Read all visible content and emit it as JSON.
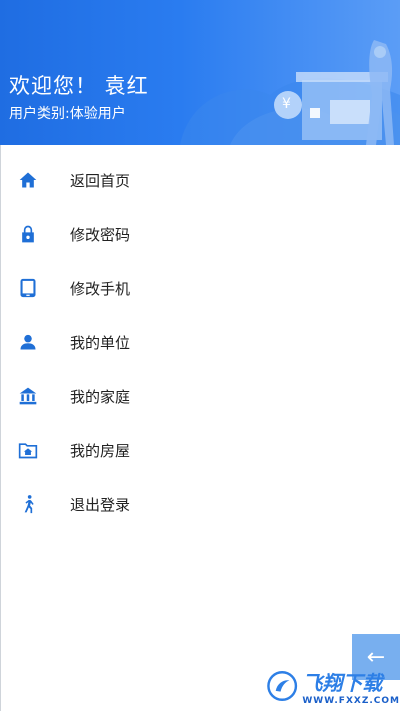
{
  "header": {
    "welcome": "欢迎您！ 袁红",
    "user_type": "用户类别:体验用户",
    "art_symbol": "¥"
  },
  "menu": {
    "items": [
      {
        "label": "返回首页",
        "icon": "home-icon"
      },
      {
        "label": "修改密码",
        "icon": "lock-icon"
      },
      {
        "label": "修改手机",
        "icon": "phone-icon"
      },
      {
        "label": "我的单位",
        "icon": "person-icon"
      },
      {
        "label": "我的家庭",
        "icon": "bank-icon"
      },
      {
        "label": "我的房屋",
        "icon": "house-folder-icon"
      },
      {
        "label": "退出登录",
        "icon": "runner-icon"
      }
    ]
  },
  "fab": {
    "icon": "arrow-left-icon",
    "glyph": "←"
  },
  "watermark": {
    "brand": "飞翔下载",
    "url": "WWW.FXXZ.COM"
  },
  "colors": {
    "accent": "#2a7cf0",
    "icon": "#1f6fd6",
    "text": "#222222"
  }
}
